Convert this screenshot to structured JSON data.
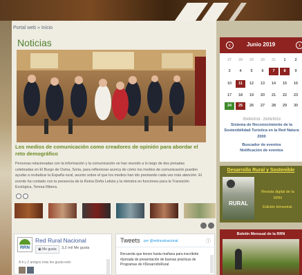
{
  "breadcrumb": {
    "text": "Portal web » Inicio"
  },
  "news": {
    "section_title": "Noticias",
    "headline": "Los medios de comunicación como creadores de opinión para abordar el reto demográfico",
    "body": "Personas relacionadas con la información y la comunicación se han reunido a lo largo de dos jornadas celebradas en El Burgo de Osma, Soria, para reflexionar acerca de cómo los medios de comunicación pueden ayudar a revitalizar la España rural, asunto sobre el que los medios han ido prestando cada vez más atención. El evento ha contado con la presencia de la Reina Doña Letizia y la ministra en funciones para la Transición Ecológica, Teresa Ribera."
  },
  "rrn": {
    "name": "Red Rural Nacional",
    "logo_text": "RRN",
    "like_button": "Me gusta",
    "likes": "3,2 mil Me gusta",
    "friends_like": "A ti y 2 amigos más les gusta esto"
  },
  "tweets": {
    "title": "Tweets",
    "by": "por @redruralnacional",
    "text": "Recuerda que tienes hasta mañana para inscribirte #jornada de presentación de buenas prácticas de Programas de #DesarrolloRural"
  },
  "calendar": {
    "month": "Junio 2019",
    "prev_icon": "‹",
    "next_icon": "›",
    "rows": [
      [
        "27",
        "28",
        "29",
        "30",
        "31",
        "1",
        "2"
      ],
      [
        "3",
        "4",
        "5",
        "6",
        "7",
        "8",
        "9"
      ],
      [
        "10",
        "11",
        "12",
        "13",
        "14",
        "15",
        "16"
      ],
      [
        "17",
        "18",
        "19",
        "20",
        "21",
        "22",
        "23"
      ],
      [
        "24",
        "25",
        "26",
        "27",
        "28",
        "29",
        "30"
      ]
    ],
    "date_range": "25/06/2019 - 25/06/2019",
    "event": "Sistema de Reconocimiento de la Sostenibilidad Turística en la Red Natura 2000",
    "search_events": "Buscador de eventos",
    "event_notify": "Notificación de eventos",
    "colors": {
      "header": "#8e2320",
      "highlight": "#8e2320",
      "today": "#3c8a2a"
    }
  },
  "desarrollo": {
    "title": "Desarrollo Rural y Sostenible",
    "magazine_line1": "Revista digital de la",
    "magazine_line2": "RRN",
    "frequency": "Edición trimestral.",
    "cover_text": "RURAL"
  },
  "boletin": {
    "title": "Boletín Mensual de la RRN"
  }
}
